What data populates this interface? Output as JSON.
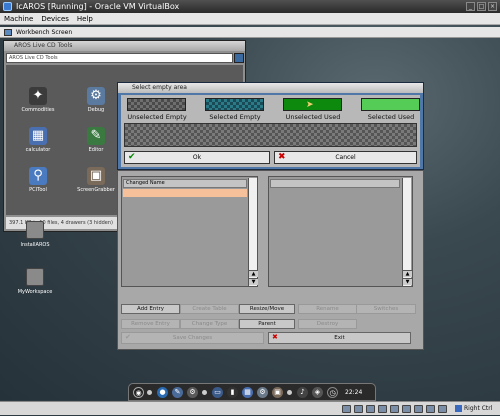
{
  "host": {
    "title": "IcAROS [Running] - Oracle VM VirtualBox",
    "menu": [
      "Machine",
      "Devices",
      "Help"
    ],
    "host_key": "Right Ctrl"
  },
  "workbench": {
    "title": "Workbench Screen",
    "desktop_icons": [
      {
        "label": "InstallAROS",
        "icon": "installer-icon"
      },
      {
        "label": "MyWorkspace",
        "icon": "workspace-icon"
      }
    ]
  },
  "live_cd_window": {
    "title": "AROS Live CD Tools",
    "path": "AROS Live CD Tools",
    "icons": [
      {
        "label": "Commodities",
        "icon": "commodities-icon",
        "color": "#3b3b3b"
      },
      {
        "label": "Debug",
        "icon": "debug-icon",
        "color": "#5a7aa0"
      },
      {
        "label": "calculator",
        "icon": "calculator-icon",
        "color": "#4a6fb0"
      },
      {
        "label": "Editor",
        "icon": "editor-icon",
        "color": "#3a7a40"
      },
      {
        "label": "PCITool",
        "icon": "pcitool-icon",
        "color": "#4a7ac0"
      },
      {
        "label": "ScreenGrabber",
        "icon": "screengrabber-icon",
        "color": "#7a6a5a"
      }
    ],
    "status": "397.1 KB in 10 files, 4 drawers (3 hidden)"
  },
  "select_dialog": {
    "title": "Select empty area",
    "swatches": [
      {
        "label": "Unselected Empty",
        "color": "#6f6f6f",
        "pattern": "checker-gray"
      },
      {
        "label": "Selected Empty",
        "color": "#2a7a88",
        "pattern": "checker-teal"
      },
      {
        "label": "Unselected Used",
        "color": "#0d8a0d",
        "pattern": "solid"
      },
      {
        "label": "Selected Used",
        "color": "#55cc55",
        "pattern": "solid"
      }
    ],
    "ok_label": "Ok",
    "cancel_label": "Cancel"
  },
  "main_window": {
    "list_header": "Changed Name",
    "selected_row_color": "#f5c09a",
    "buttons_row1": [
      {
        "label": "Add Entry",
        "enabled": true
      },
      {
        "label": "Create Table",
        "enabled": false
      },
      {
        "label": "Resize/Move",
        "enabled": true
      },
      {
        "label": "Rename",
        "enabled": false
      },
      {
        "label": "Switches",
        "enabled": false
      }
    ],
    "buttons_row2": [
      {
        "label": "Remove Entry",
        "enabled": false
      },
      {
        "label": "Change Type",
        "enabled": false
      },
      {
        "label": "Parent",
        "enabled": true
      },
      {
        "label": "Destroy",
        "enabled": false
      }
    ],
    "save_label": "Save Changes",
    "exit_label": "Exit"
  },
  "dock": {
    "clock": "22:24",
    "icons": [
      "aros-logo-icon",
      "globe-icon",
      "tool-icon",
      "gear-icon",
      "computer-icon",
      "terminal-icon",
      "calculator-icon",
      "settings-icon",
      "display-icon",
      "sound-icon"
    ]
  }
}
